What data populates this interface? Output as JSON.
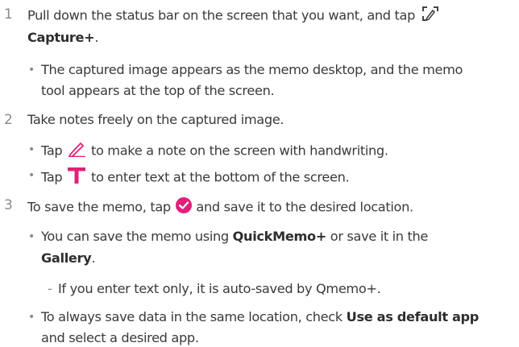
{
  "steps": [
    {
      "number": "1",
      "line1_before": "Pull down the status bar on the screen that you want, and tap",
      "line2_bold": "Capture+",
      "line2_after": ".",
      "bullets": [
        {
          "line1": "The captured image appears as the memo desktop, and the memo",
          "line2": "tool appears at the top of the screen."
        }
      ]
    },
    {
      "number": "2",
      "text": "Take notes freely on the captured image.",
      "bullets": [
        {
          "before": "Tap",
          "after": "to make a note on the screen with handwriting."
        },
        {
          "before": "Tap",
          "after": "to enter text at the bottom of the screen."
        }
      ]
    },
    {
      "number": "3",
      "before": "To save the memo, tap",
      "after": "and save it to the desired location.",
      "bullet1": {
        "before": "You can save the memo using",
        "bold1": "QuickMemo+",
        "middle": "or save it in the",
        "bold2": "Gallery",
        "end": "."
      },
      "subitem": "If you enter text only, it is auto-saved by Qmemo+.",
      "bullet2": {
        "before": "To always save data in the same location, check",
        "bold": "Use as default app",
        "line2": "and select a desired app."
      }
    }
  ],
  "icons": {
    "capture_icon": "capture-plus-icon",
    "pen_icon": "pen-icon",
    "text_icon": "text-icon",
    "check_icon": "check-circle-icon",
    "accent_color": "#e0207a"
  }
}
